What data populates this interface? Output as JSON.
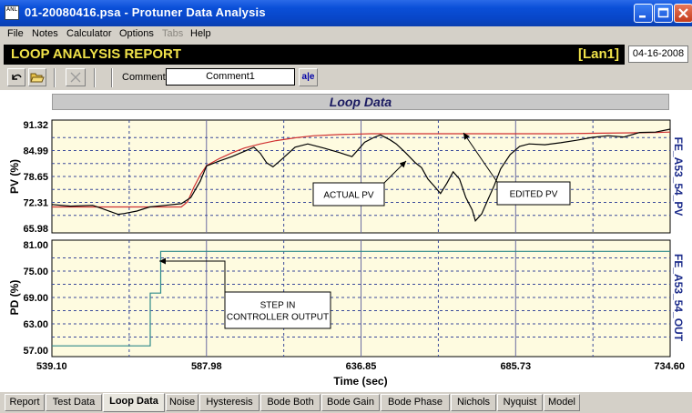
{
  "window": {
    "icon_text": "ANL",
    "title": "01-20080416.psa - Protuner Data  Analysis"
  },
  "menu": [
    "File",
    "Notes",
    "Calculator",
    "Options",
    "Tabs",
    "Help"
  ],
  "header": {
    "title": "LOOP ANALYSIS REPORT",
    "tag": "[Lan1]",
    "date": "04-16-2008"
  },
  "toolbar": {
    "comment_label": "Comment",
    "comment_value": "Comment1",
    "abc_label": "a|e"
  },
  "chart_data": [
    {
      "type": "line",
      "title": "Loop Data",
      "ylabel": "PV (%)",
      "right_label": "FE_A53_54_PV",
      "yticks": [
        "91.32",
        "84.99",
        "78.65",
        "72.31",
        "65.98"
      ],
      "ylim": [
        65.98,
        91.32
      ],
      "xlim": [
        539.1,
        734.6
      ],
      "series": [
        {
          "name": "ACTUAL PV",
          "color": "#000000",
          "x": [
            539.1,
            545,
            552,
            555,
            560,
            562,
            566,
            570,
            575,
            580,
            583,
            586,
            588,
            592,
            596,
            600,
            603,
            605,
            607,
            609,
            612,
            616,
            620,
            625,
            630,
            634,
            638,
            641,
            643,
            646,
            648,
            651,
            654,
            656,
            658,
            660,
            662,
            664,
            666,
            668,
            670,
            672,
            673,
            675,
            677,
            679,
            681,
            684,
            687,
            690,
            695,
            700,
            705,
            710,
            715,
            720,
            725,
            730,
            734.6
          ],
          "y": [
            71.8,
            71.4,
            71.6,
            70.8,
            69.4,
            69.6,
            70.2,
            71.2,
            71.6,
            72.0,
            73.5,
            77.5,
            81.2,
            82.4,
            83.5,
            84.8,
            85.8,
            84.3,
            82.0,
            81.0,
            83.0,
            85.8,
            86.6,
            85.6,
            84.5,
            83.5,
            87.0,
            88.2,
            88.8,
            87.6,
            86.6,
            84.4,
            82.0,
            80.8,
            78.0,
            76.3,
            74.5,
            77.0,
            79.8,
            78.0,
            73.5,
            70.5,
            67.8,
            69.5,
            73.0,
            76.5,
            80.5,
            84.0,
            86.0,
            86.6,
            86.4,
            86.9,
            87.5,
            88.2,
            88.6,
            88.3,
            89.4,
            89.5,
            90.2
          ]
        },
        {
          "name": "EDITED PV",
          "color": "#d03030",
          "x": [
            539.1,
            580,
            582,
            584,
            586,
            588,
            592,
            596,
            600,
            605,
            610,
            616,
            622,
            630,
            640,
            650,
            660,
            670,
            680,
            690,
            700,
            710,
            720,
            730,
            734.6
          ],
          "y": [
            71.2,
            71.2,
            72.5,
            76.0,
            79.0,
            81.3,
            83.0,
            84.4,
            85.6,
            86.6,
            87.4,
            88.1,
            88.6,
            88.9,
            89.1,
            89.1,
            89.1,
            89.1,
            89.1,
            89.1,
            89.1,
            89.2,
            89.3,
            89.4,
            89.5
          ]
        }
      ],
      "annotations": [
        {
          "text": "ACTUAL PV"
        },
        {
          "text": "EDITED PV"
        }
      ]
    },
    {
      "type": "line",
      "ylabel": "PD (%)",
      "right_label": "FE_A53_54_OUT",
      "xlabel": "Time (sec)",
      "yticks": [
        "81.00",
        "75.00",
        "69.00",
        "63.00",
        "57.00"
      ],
      "xticks": [
        "539.10",
        "587.98",
        "636.85",
        "685.73",
        "734.60"
      ],
      "ylim": [
        57.0,
        81.0
      ],
      "xlim": [
        539.1,
        734.6
      ],
      "series": [
        {
          "name": "CONTROLLER OUTPUT",
          "color": "#2e8a8a",
          "x": [
            539.1,
            570.2,
            570.2,
            573.5,
            573.5,
            734.6
          ],
          "y": [
            58.0,
            58.0,
            70.0,
            70.0,
            79.5,
            79.5
          ]
        }
      ],
      "annotations": [
        {
          "text": "STEP IN\nCONTROLLER OUTPUT"
        }
      ]
    }
  ],
  "tabs": [
    {
      "label": "Report",
      "active": false
    },
    {
      "label": "Test Data",
      "active": false
    },
    {
      "label": "Loop Data",
      "active": true
    },
    {
      "label": "Noise",
      "active": false
    },
    {
      "label": "Hysteresis",
      "active": false
    },
    {
      "label": "Bode Both",
      "active": false
    },
    {
      "label": "Bode Gain",
      "active": false
    },
    {
      "label": "Bode Phase",
      "active": false
    },
    {
      "label": "Nichols",
      "active": false
    },
    {
      "label": "Nyquist",
      "active": false
    },
    {
      "label": "Model",
      "active": false
    }
  ]
}
